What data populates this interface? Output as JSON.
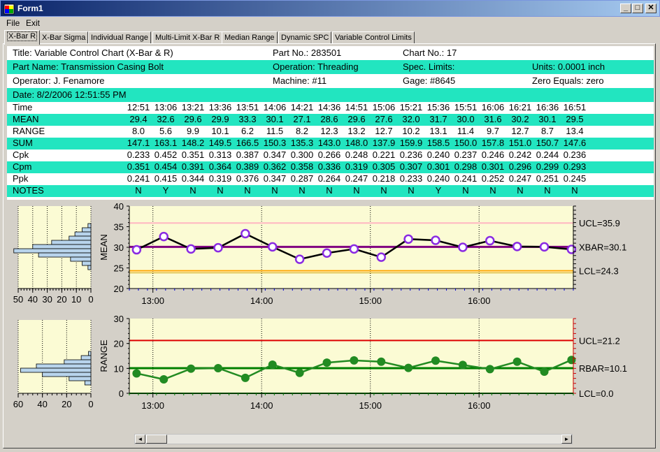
{
  "window": {
    "title": "Form1",
    "minimize": "_",
    "maximize": "□",
    "close": "✕"
  },
  "menu": [
    "File",
    "Exit"
  ],
  "tabs": [
    "X-Bar R",
    "X-Bar Sigma",
    "Individual Range",
    "Multi-Limit X-Bar R",
    "Median Range",
    "Dynamic SPC",
    "Variable Control Limits"
  ],
  "header": {
    "title": "Title: Variable Control Chart (X-Bar & R)",
    "part_no": "Part No.: 283501",
    "chart_no": "Chart No.: 17",
    "part_name": "Part Name: Transmission Casing Bolt",
    "operation": "Operation: Threading",
    "spec_limits": "Spec. Limits:",
    "units": "Units: 0.0001 inch",
    "operator": "Operator: J. Fenamore",
    "machine": "Machine: #11",
    "gage": "Gage: #8645",
    "zero_equals": "Zero Equals: zero",
    "date": "Date: 8/2/2006 12:51:55 PM"
  },
  "table": {
    "rows": [
      {
        "label": "Time",
        "teal": false,
        "values": [
          "12:51",
          "13:06",
          "13:21",
          "13:36",
          "13:51",
          "14:06",
          "14:21",
          "14:36",
          "14:51",
          "15:06",
          "15:21",
          "15:36",
          "15:51",
          "16:06",
          "16:21",
          "16:36",
          "16:51"
        ]
      },
      {
        "label": "MEAN",
        "teal": true,
        "values": [
          "29.4",
          "32.6",
          "29.6",
          "29.9",
          "33.3",
          "30.1",
          "27.1",
          "28.6",
          "29.6",
          "27.6",
          "32.0",
          "31.7",
          "30.0",
          "31.6",
          "30.2",
          "30.1",
          "29.5"
        ]
      },
      {
        "label": "RANGE",
        "teal": false,
        "values": [
          "8.0",
          "5.6",
          "9.9",
          "10.1",
          "6.2",
          "11.5",
          "8.2",
          "12.3",
          "13.2",
          "12.7",
          "10.2",
          "13.1",
          "11.4",
          "9.7",
          "12.7",
          "8.7",
          "13.4"
        ]
      },
      {
        "label": "SUM",
        "teal": true,
        "values": [
          "147.1",
          "163.1",
          "148.2",
          "149.5",
          "166.5",
          "150.3",
          "135.3",
          "143.0",
          "148.0",
          "137.9",
          "159.9",
          "158.5",
          "150.0",
          "157.8",
          "151.0",
          "150.7",
          "147.6"
        ]
      },
      {
        "label": "Cpk",
        "teal": false,
        "values": [
          "0.233",
          "0.452",
          "0.351",
          "0.313",
          "0.387",
          "0.347",
          "0.300",
          "0.266",
          "0.248",
          "0.221",
          "0.236",
          "0.240",
          "0.237",
          "0.246",
          "0.242",
          "0.244",
          "0.236"
        ]
      },
      {
        "label": "Cpm",
        "teal": true,
        "values": [
          "0.351",
          "0.454",
          "0.391",
          "0.364",
          "0.389",
          "0.362",
          "0.358",
          "0.336",
          "0.319",
          "0.305",
          "0.307",
          "0.301",
          "0.298",
          "0.301",
          "0.296",
          "0.299",
          "0.293"
        ]
      },
      {
        "label": "Ppk",
        "teal": false,
        "values": [
          "0.241",
          "0.415",
          "0.344",
          "0.319",
          "0.376",
          "0.347",
          "0.287",
          "0.264",
          "0.247",
          "0.218",
          "0.233",
          "0.240",
          "0.241",
          "0.252",
          "0.247",
          "0.251",
          "0.245"
        ]
      },
      {
        "label": "NOTES",
        "teal": true,
        "values": [
          "N",
          "Y",
          "N",
          "N",
          "N",
          "N",
          "N",
          "N",
          "N",
          "N",
          "N",
          "Y",
          "N",
          "N",
          "N",
          "N",
          "N"
        ]
      }
    ]
  },
  "chart_data": [
    {
      "type": "line",
      "ylabel": "MEAN",
      "ylim": [
        20,
        40
      ],
      "yticks": [
        20,
        25,
        30,
        35,
        40
      ],
      "xticks": [
        "13:00",
        "14:00",
        "15:00",
        "16:00"
      ],
      "x": [
        "12:51",
        "13:06",
        "13:21",
        "13:36",
        "13:51",
        "14:06",
        "14:21",
        "14:36",
        "14:51",
        "15:06",
        "15:21",
        "15:36",
        "15:51",
        "16:06",
        "16:21",
        "16:36",
        "16:51"
      ],
      "values": [
        29.4,
        32.6,
        29.6,
        29.9,
        33.3,
        30.1,
        27.1,
        28.6,
        29.6,
        27.6,
        32.0,
        31.7,
        30.0,
        31.6,
        30.2,
        30.1,
        29.5
      ],
      "limits": {
        "ucl": 35.9,
        "center": 30.1,
        "lcl": 24.3
      },
      "limit_labels": {
        "ucl": "UCL=35.9",
        "center": "XBAR=30.1",
        "lcl": "LCL=24.3"
      },
      "colors": {
        "line": "#000000",
        "marker": "#8a2be2",
        "ucl": "#ffb6c1",
        "center": "#800080",
        "lcl": "#ffa500"
      }
    },
    {
      "type": "line",
      "ylabel": "RANGE",
      "ylim": [
        0,
        30
      ],
      "yticks": [
        0,
        10,
        20,
        30
      ],
      "xticks": [
        "13:00",
        "14:00",
        "15:00",
        "16:00"
      ],
      "x": [
        "12:51",
        "13:06",
        "13:21",
        "13:36",
        "13:51",
        "14:06",
        "14:21",
        "14:36",
        "14:51",
        "15:06",
        "15:21",
        "15:36",
        "15:51",
        "16:06",
        "16:21",
        "16:36",
        "16:51"
      ],
      "values": [
        8.0,
        5.6,
        9.9,
        10.1,
        6.2,
        11.5,
        8.2,
        12.3,
        13.2,
        12.7,
        10.2,
        13.1,
        11.4,
        9.7,
        12.7,
        8.7,
        13.4
      ],
      "limits": {
        "ucl": 21.2,
        "center": 10.1,
        "lcl": 0.0
      },
      "limit_labels": {
        "ucl": "UCL=21.2",
        "center": "RBAR=10.1",
        "lcl": "LCL=0.0"
      },
      "colors": {
        "line": "#228b22",
        "marker": "#228b22",
        "ucl": "#dd0000",
        "center": "#008000",
        "lcl": "#008000"
      }
    },
    {
      "type": "bar",
      "orientation": "horizontal",
      "xticks": [
        "50",
        "40",
        "30",
        "20",
        "10",
        "0"
      ],
      "xlim": [
        50,
        0
      ]
    },
    {
      "type": "bar",
      "orientation": "horizontal",
      "xticks": [
        "60",
        "40",
        "20",
        "0"
      ],
      "xlim": [
        60,
        0
      ]
    }
  ]
}
